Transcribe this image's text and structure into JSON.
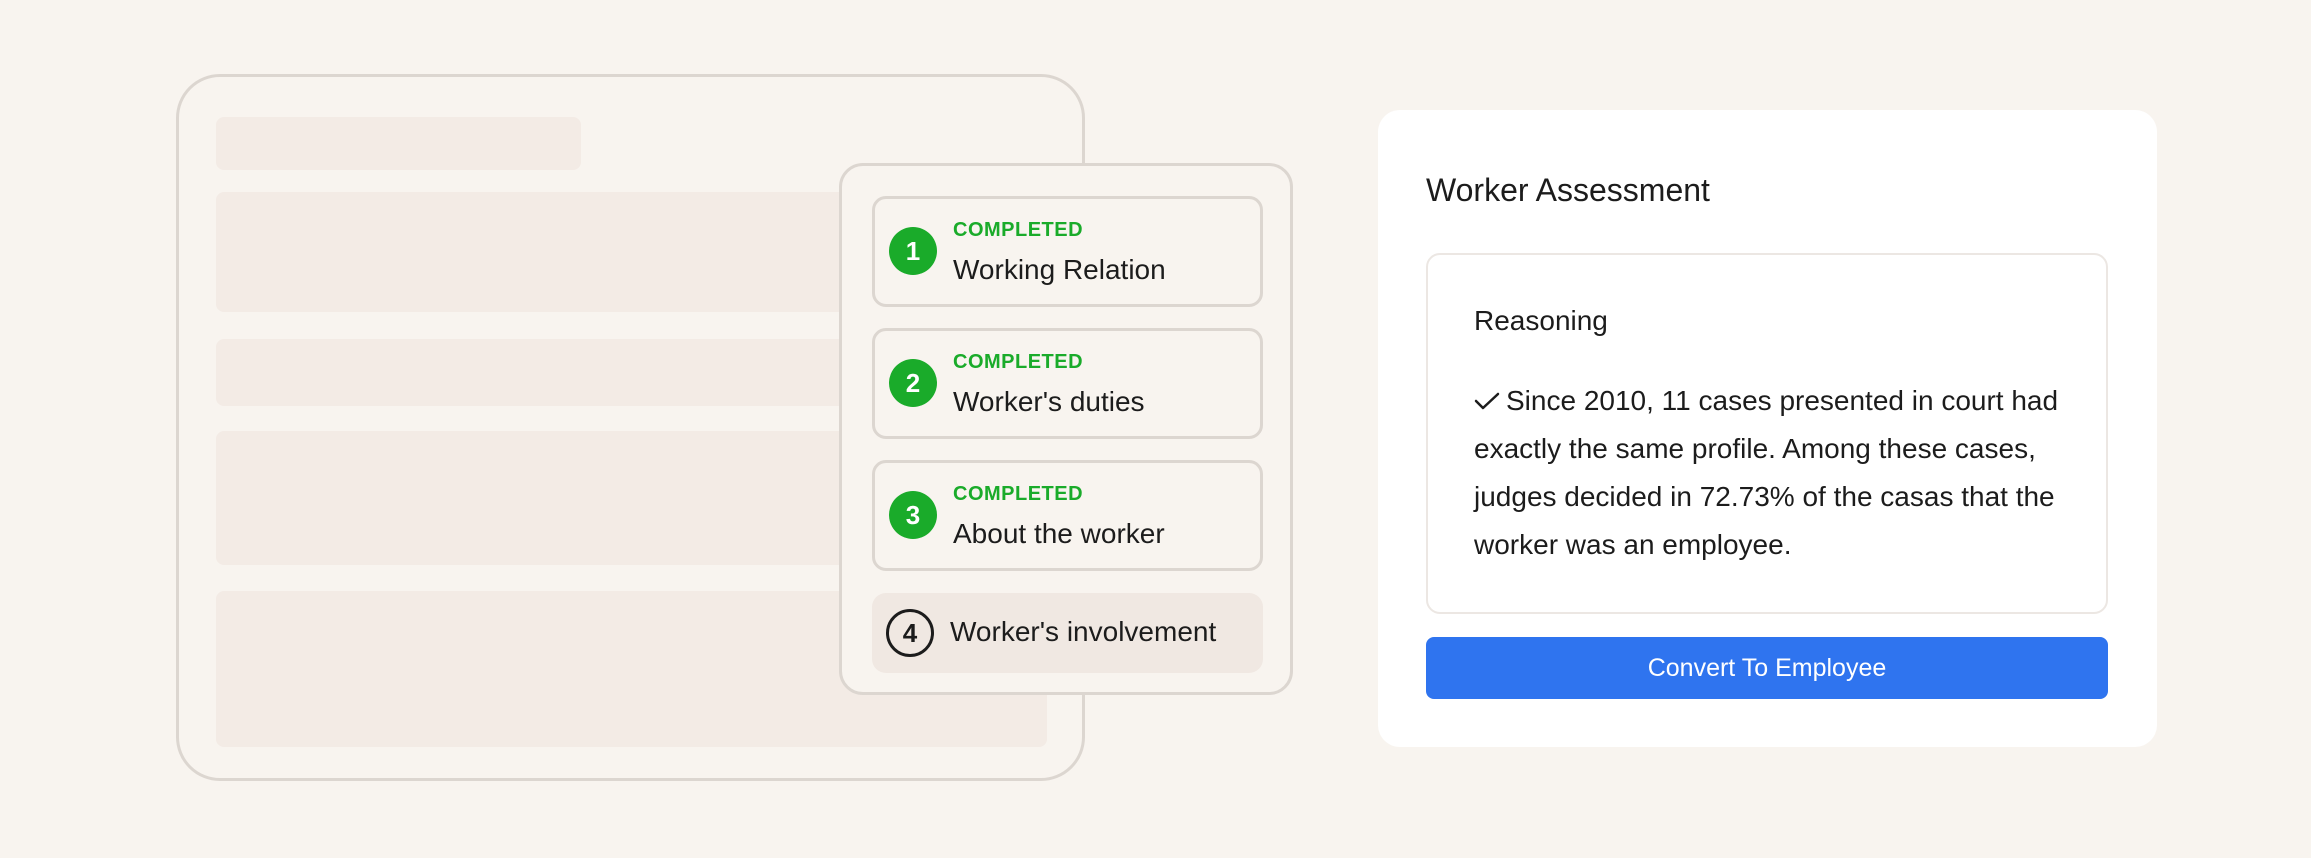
{
  "steps": [
    {
      "number": "1",
      "status": "COMPLETED",
      "title": "Working Relation"
    },
    {
      "number": "2",
      "status": "COMPLETED",
      "title": "Worker's duties"
    },
    {
      "number": "3",
      "status": "COMPLETED",
      "title": "About the worker"
    },
    {
      "number": "4",
      "status": "",
      "title": "Worker's involvement"
    }
  ],
  "assessment": {
    "title": "Worker Assessment",
    "reasoning_title": "Reasoning",
    "reasoning_text": "Since 2010, 11 cases presented in court had exactly the same profile. Among these cases, judges decided in 72.73% of the casas that the worker was an employee.",
    "button_label": "Convert To Employee"
  },
  "colors": {
    "background": "#f8f4ef",
    "completed_green": "#1aab2a",
    "button_blue": "#2f74ef"
  },
  "icons": {
    "reasoning_marker": "check-icon"
  }
}
